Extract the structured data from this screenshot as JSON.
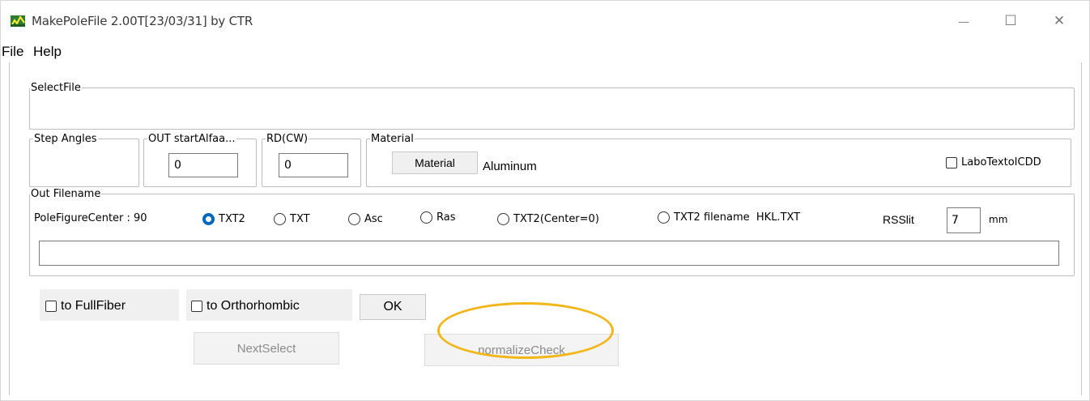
{
  "window": {
    "title": "MakePoleFile 2.00T[23/03/31] by CTR",
    "minimize_glyph": "—",
    "maximize_glyph": "☐",
    "close_glyph": "✕"
  },
  "menu": {
    "file": "File",
    "help": "Help"
  },
  "select_file": {
    "legend": "SelectFile"
  },
  "step_angles": {
    "legend": "Step Angles"
  },
  "out_start_alfa": {
    "legend": "OUT startAlfaa...",
    "value": "0"
  },
  "rd_cw": {
    "legend": "RD(CW)",
    "value": "0"
  },
  "material": {
    "legend": "Material",
    "button_label": "Material",
    "value": "Aluminum",
    "labo_checkbox_label": "LaboTextoICDD"
  },
  "out_filename": {
    "legend": "Out Filename",
    "pole_figure_center": "PoleFigureCenter : 90",
    "radios": [
      {
        "label": "TXT2",
        "selected": true
      },
      {
        "label": "TXT",
        "selected": false
      },
      {
        "label": "Asc",
        "selected": false
      },
      {
        "label": "Ras",
        "selected": false
      },
      {
        "label": "TXT2(Center=0)",
        "selected": false
      },
      {
        "label": "TXT2 filename  HKL.TXT",
        "selected": false
      }
    ],
    "rsslit_label": "RSSlit",
    "rsslit_value": "7",
    "rsslit_unit": "mm",
    "filename_value": ""
  },
  "options": {
    "full_fiber": "to FullFiber",
    "orthorhombic": "to Orthorhombic",
    "ok_button": "OK",
    "next_select_button": "NextSelect",
    "normalize_check_button": "normalizeCheck"
  },
  "colors": {
    "accent": "#0067c0",
    "highlight": "#f2b619"
  }
}
